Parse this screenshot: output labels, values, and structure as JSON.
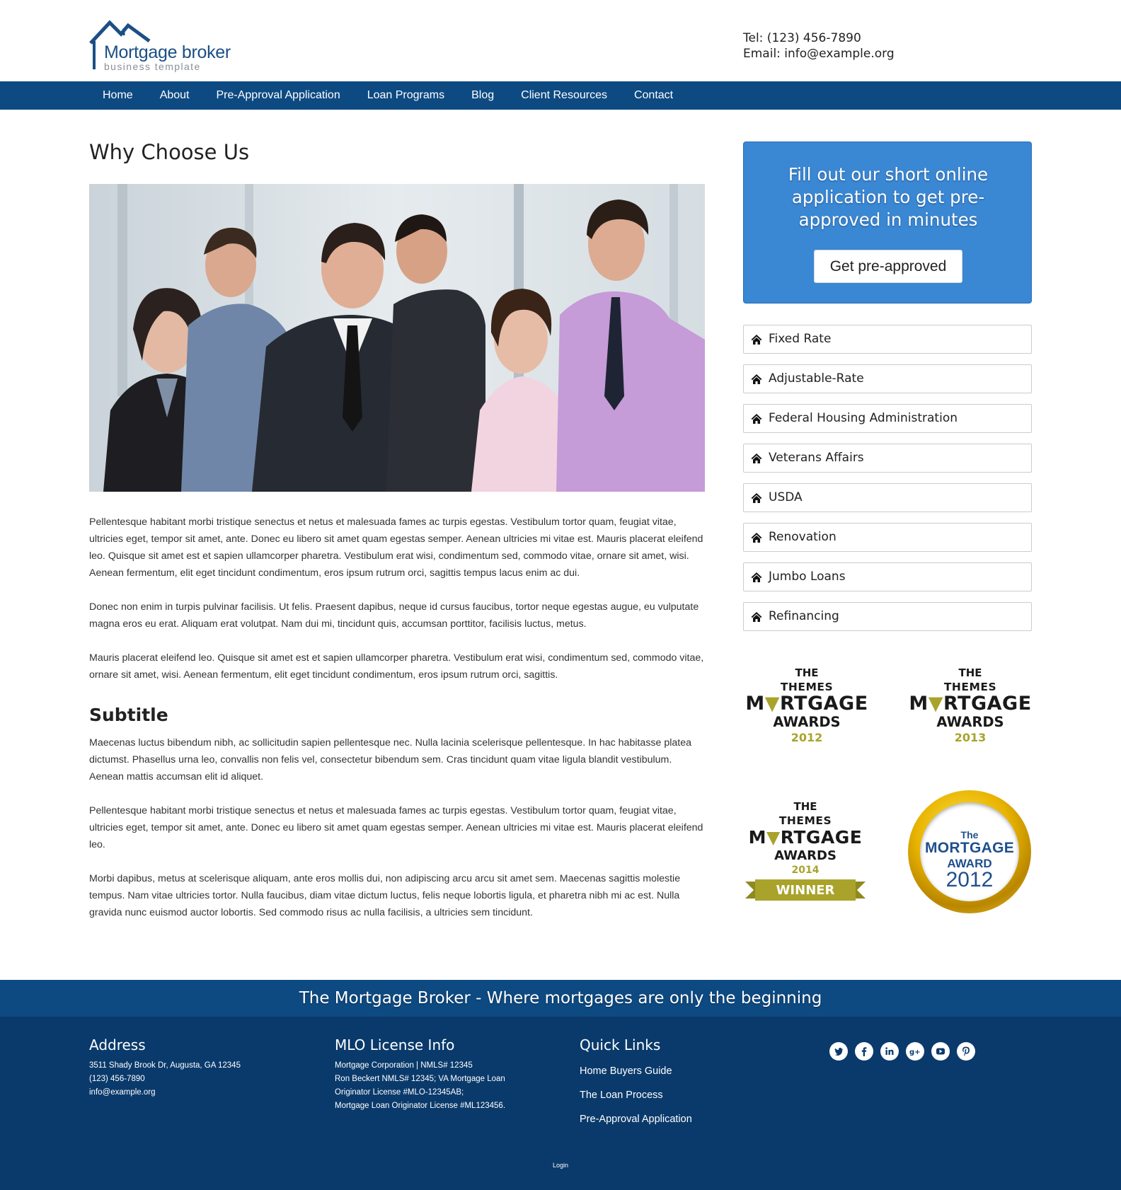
{
  "header": {
    "logo": {
      "name": "Mortgage broker",
      "tagline": "business template"
    },
    "contact": {
      "phone": "Tel: (123) 456-7890",
      "email": "Email: info@example.org"
    }
  },
  "nav": {
    "items": [
      "Home",
      "About",
      "Pre-Approval Application",
      "Loan Programs",
      "Blog",
      "Client Resources",
      "Contact"
    ]
  },
  "main": {
    "title": "Why Choose Us",
    "paragraphs": [
      "Pellentesque habitant morbi tristique senectus et netus et malesuada fames ac turpis egestas. Vestibulum tortor quam, feugiat vitae, ultricies eget, tempor sit amet, ante. Donec eu libero sit amet quam egestas semper. Aenean ultricies mi vitae est. Mauris placerat eleifend leo. Quisque sit amet est et sapien ullamcorper pharetra. Vestibulum erat wisi, condimentum sed, commodo vitae, ornare sit amet, wisi. Aenean fermentum, elit eget tincidunt condimentum, eros ipsum rutrum orci, sagittis tempus lacus enim ac dui.",
      "Donec non enim in turpis pulvinar facilisis. Ut felis. Praesent dapibus, neque id cursus faucibus, tortor neque egestas augue, eu vulputate magna eros eu erat. Aliquam erat volutpat. Nam dui mi, tincidunt quis, accumsan porttitor, facilisis luctus, metus.",
      "Mauris placerat eleifend leo. Quisque sit amet est et sapien ullamcorper pharetra. Vestibulum erat wisi, condimentum sed, commodo vitae, ornare sit amet, wisi. Aenean fermentum, elit eget tincidunt condimentum, eros ipsum rutrum orci, sagittis."
    ],
    "subtitle": "Subtitle",
    "sub_paragraphs": [
      "Maecenas luctus bibendum nibh, ac sollicitudin sapien pellentesque nec. Nulla lacinia scelerisque pellentesque. In hac habitasse platea dictumst. Phasellus urna leo, convallis non felis vel, consectetur bibendum sem. Cras tincidunt quam vitae ligula blandit vestibulum. Aenean mattis accumsan elit id aliquet.",
      "Pellentesque habitant morbi tristique senectus et netus et malesuada fames ac turpis egestas. Vestibulum tortor quam, feugiat vitae, ultricies eget, tempor sit amet, ante. Donec eu libero sit amet quam egestas semper. Aenean ultricies mi vitae est. Mauris placerat eleifend leo.",
      "Morbi dapibus, metus at scelerisque aliquam, ante eros mollis dui, non adipiscing arcu arcu sit amet sem. Maecenas sagittis molestie tempus. Nam vitae ultricies tortor. Nulla faucibus, diam vitae dictum luctus, felis neque lobortis ligula, et pharetra nibh mi ac est. Nulla gravida nunc euismod auctor lobortis. Sed commodo risus ac nulla facilisis, a ultricies sem tincidunt."
    ]
  },
  "sidebar": {
    "cta": {
      "text": "Fill out our short online application to get pre-approved in minutes",
      "button": "Get pre-approved"
    },
    "programs": [
      "Fixed Rate",
      "Adjustable-Rate",
      "Federal Housing Administration",
      "Veterans Affairs",
      "USDA",
      "Renovation",
      "Jumbo Loans",
      "Refinancing"
    ],
    "awards": [
      {
        "l1": "THE",
        "l2": "THEMES",
        "l3a": "M",
        "l3b": "RTGAGE",
        "l4": "AWARDS",
        "year": "2012"
      },
      {
        "l1": "THE",
        "l2": "THEMES",
        "l3a": "M",
        "l3b": "RTGAGE",
        "l4": "AWARDS",
        "year": "2013"
      },
      {
        "l1": "THE",
        "l2": "THEMES",
        "l3a": "M",
        "l3b": "RTGAGE",
        "l4": "AWARDS",
        "year": "2014",
        "banner": "WINNER"
      }
    ],
    "ring_award": {
      "l1": "The",
      "l2": "MORTGAGE",
      "l3": "AWARD",
      "year": "2012"
    }
  },
  "footer": {
    "tagline": "The Mortgage Broker - Where mortgages are only the beginning",
    "address": {
      "heading": "Address",
      "lines": [
        "3511 Shady Brook Dr, Augusta, GA 12345",
        "(123) 456-7890",
        "info@example.org"
      ]
    },
    "license": {
      "heading": "MLO License Info",
      "lines": [
        "Mortgage Corporation | NMLS# 12345",
        "Ron Beckert NMLS# 12345; VA Mortgage Loan",
        "Originator License #MLO-12345AB;",
        "Mortgage Loan Originator License #ML123456."
      ]
    },
    "quick_links": {
      "heading": "Quick Links",
      "items": [
        "Home Buyers Guide",
        "The Loan Process",
        "Pre-Approval Application"
      ]
    },
    "socials": [
      "twitter-icon",
      "facebook-icon",
      "linkedin-icon",
      "google-plus-icon",
      "youtube-icon",
      "pinterest-icon"
    ],
    "login": "Login"
  },
  "colors": {
    "nav": "#0e4a82",
    "footer": "#0a3a6b",
    "cta": "#3a87d4",
    "award_gold": "#a9a32c"
  }
}
